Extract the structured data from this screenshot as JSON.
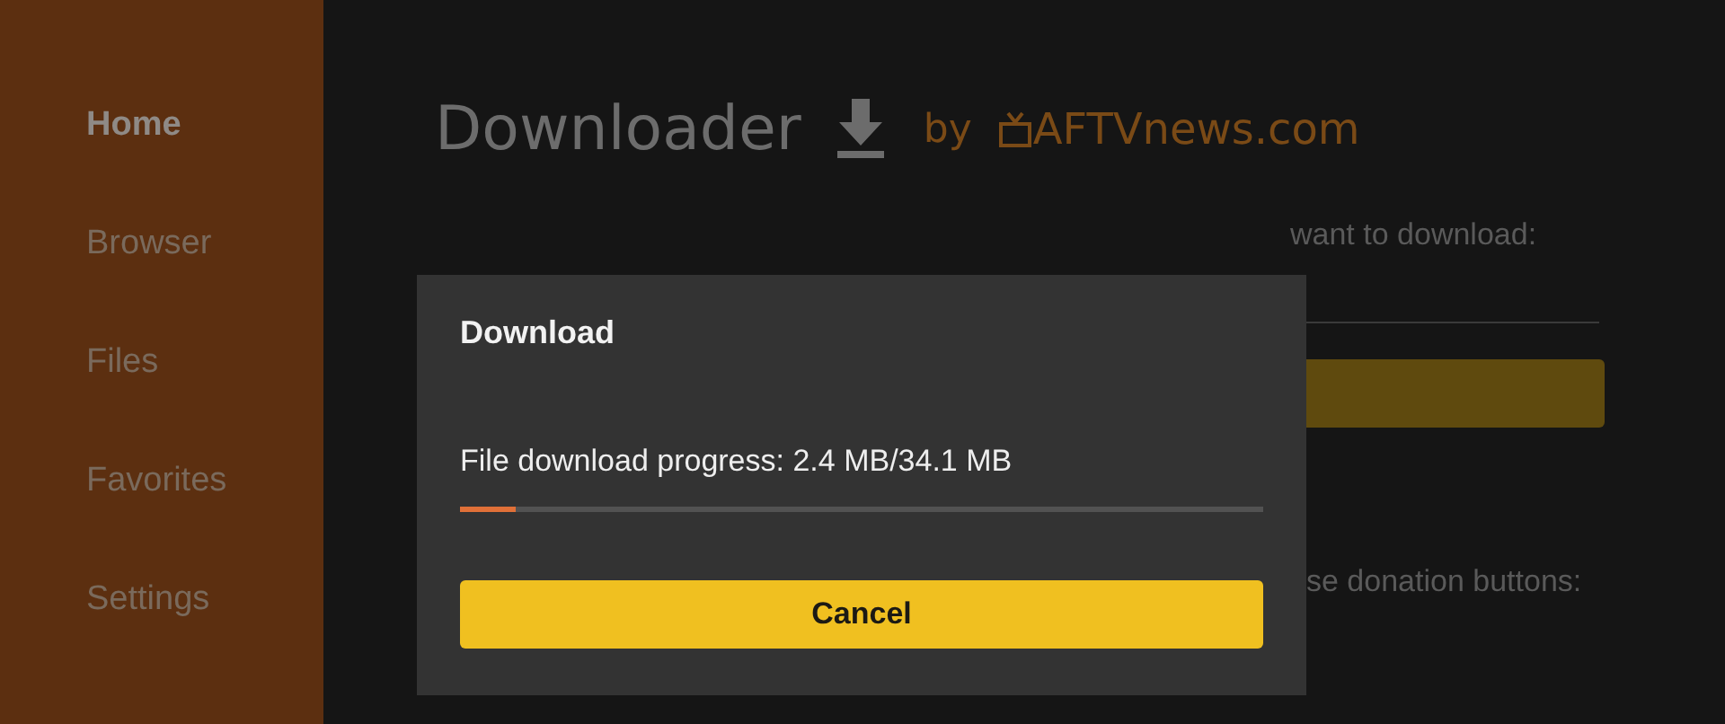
{
  "sidebar": {
    "items": [
      {
        "label": "Home",
        "selected": true
      },
      {
        "label": "Browser",
        "selected": false
      },
      {
        "label": "Files",
        "selected": false
      },
      {
        "label": "Favorites",
        "selected": false
      },
      {
        "label": "Settings",
        "selected": false
      }
    ]
  },
  "header": {
    "title": "Downloader",
    "by": "by",
    "brand": "AFTVnews.com"
  },
  "background": {
    "prompt": "want to download:",
    "donation_text": "se donation buttons:"
  },
  "dialog": {
    "title": "Download",
    "progress_text": "File download progress: 2.4 MB/34.1 MB",
    "level": 0.07,
    "button": "Cancel"
  }
}
